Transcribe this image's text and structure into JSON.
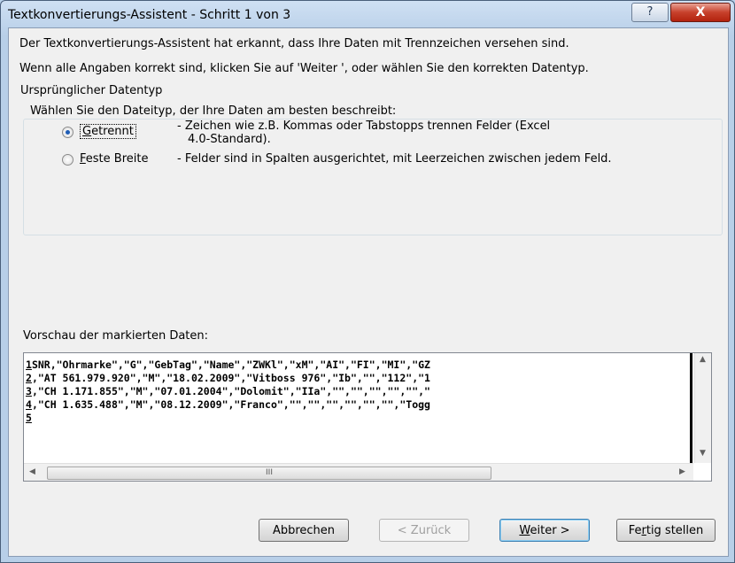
{
  "window": {
    "title": "Textkonvertierungs-Assistent - Schritt 1 von 3",
    "help_label": "?",
    "close_label": "X"
  },
  "intro": {
    "line1": "Der Textkonvertierungs-Assistent hat erkannt, dass Ihre Daten mit Trennzeichen versehen sind.",
    "line2": "Wenn alle Angaben korrekt sind, klicken Sie auf 'Weiter ', oder wählen Sie den korrekten Datentyp."
  },
  "datatype_group": {
    "legend": "Ursprünglicher Datentyp",
    "prompt": "Wählen Sie den Dateityp, der Ihre Daten am besten beschreibt:",
    "options": [
      {
        "accel": "G",
        "rest": "etrennt",
        "description_line1": "- Zeichen wie z.B. Kommas oder Tabstopps trennen Felder (Excel",
        "description_line2": "4.0-Standard).",
        "selected": true
      },
      {
        "accel": "F",
        "rest": "este Breite",
        "description_line1": "- Felder sind in Spalten ausgerichtet, mit Leerzeichen zwischen jedem Feld.",
        "selected": false
      }
    ]
  },
  "preview": {
    "label": "Vorschau der markierten Daten:",
    "rows": [
      {
        "num": "1",
        "text": "SNR,\"Ohrmarke\",\"G\",\"GebTag\",\"Name\",\"ZWKl\",\"xM\",\"AI\",\"FI\",\"MI\",\"GZ"
      },
      {
        "num": "2",
        "text": ",\"AT 561.979.920\",\"M\",\"18.02.2009\",\"Vitboss 976\",\"Ib\",\"\",\"112\",\"1"
      },
      {
        "num": "3",
        "text": ",\"CH 1.171.855\",\"M\",\"07.01.2004\",\"Dolomit\",\"IIa\",\"\",\"\",\"\",\"\",\"\",\""
      },
      {
        "num": "4",
        "text": ",\"CH 1.635.488\",\"M\",\"08.12.2009\",\"Franco\",\"\",\"\",\"\",\"\",\"\",\"\",\"Togg"
      },
      {
        "num": "5",
        "text": ""
      }
    ],
    "scroll_grip": "III"
  },
  "buttons": {
    "cancel": "Abbrechen",
    "back": "< Zurück",
    "next_accel": "W",
    "next_rest": "eiter >",
    "finish_pre": "Fe",
    "finish_accel": "r",
    "finish_rest": "tig stellen"
  }
}
